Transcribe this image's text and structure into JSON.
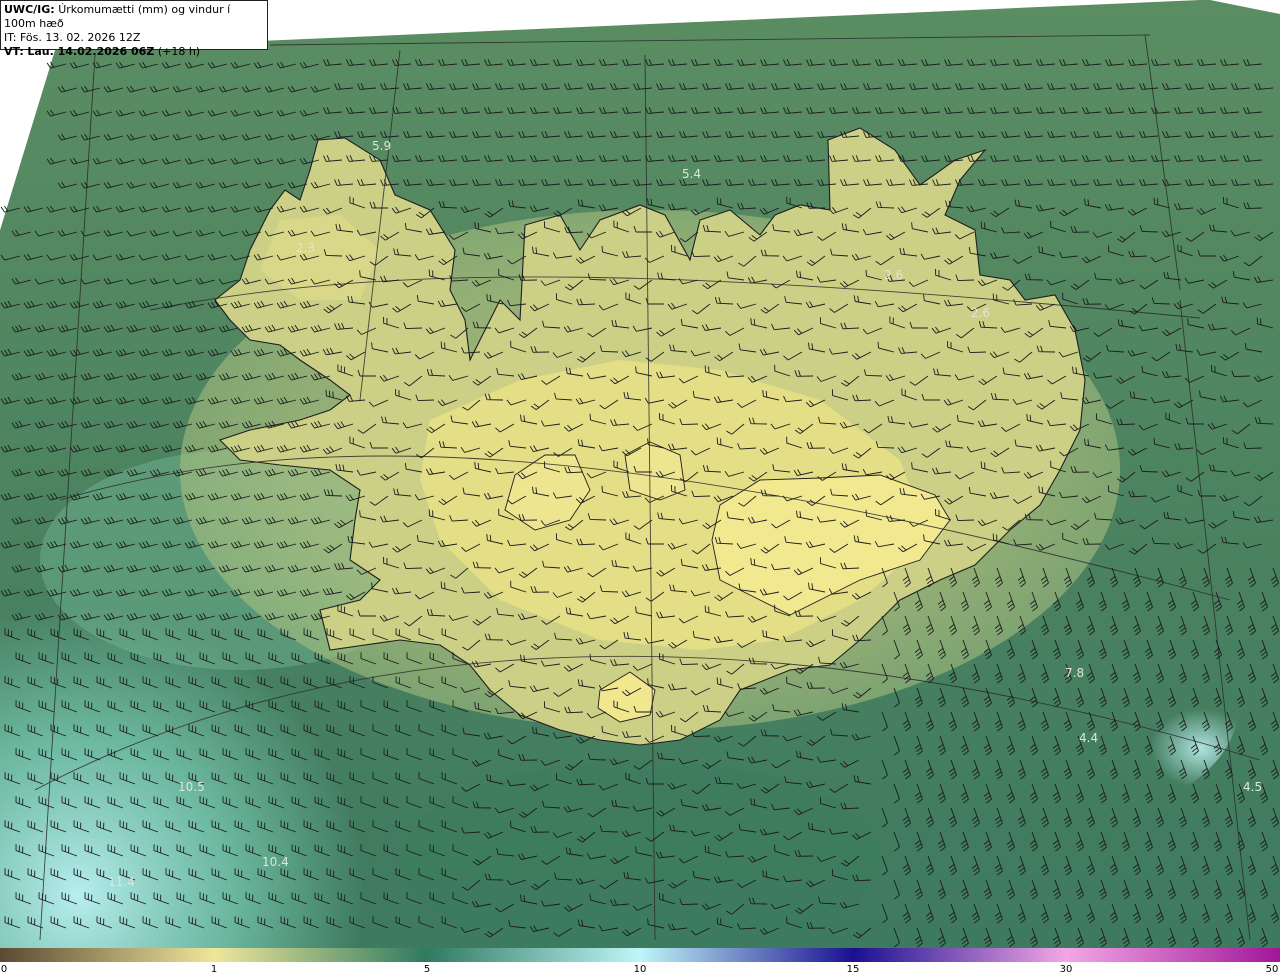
{
  "header": {
    "product": "UWC/IG:",
    "title": "Úrkomumætti (mm) og vindur í 100m hæð",
    "init_prefix": "IT:",
    "init_time": "Fös. 13. 02. 2026 12Z",
    "valid_prefix": "VT:",
    "valid_time": "Lau. 14.02.2026 06Z",
    "lead": "(+18 h)"
  },
  "map_values": [
    "5.9",
    "5.4",
    "2.3",
    "2.6",
    "2.6",
    "7.8",
    "4.4",
    "4.5",
    "10.5",
    "11.4",
    "10.4"
  ],
  "colorbar": {
    "ticks": [
      "0",
      "1",
      "5",
      "10",
      "15",
      "30",
      "50"
    ],
    "colors": {
      "t0": "#5a4a32",
      "t1": "#efe69a",
      "t5": "#2f7a60",
      "t10": "#bff5f8",
      "t15": "#1a1090",
      "t30": "#f4a6e6",
      "t50": "#a0169a"
    }
  }
}
